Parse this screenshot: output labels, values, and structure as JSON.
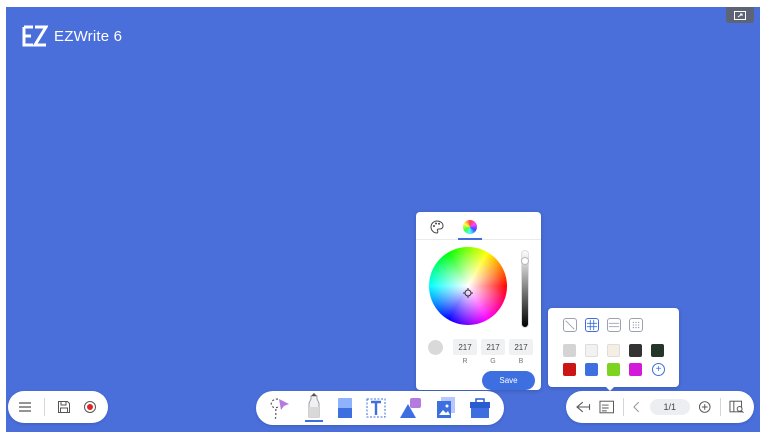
{
  "app": {
    "logo_text": "EZWrite 6"
  },
  "picker": {
    "rgb": {
      "r": "217",
      "g": "217",
      "b": "217"
    },
    "labels": {
      "r": "R",
      "g": "G",
      "b": "B"
    },
    "save_label": "Save",
    "current_color": "#d9d9d9"
  },
  "palette": {
    "swatches": [
      "#d4d4d4",
      "#f2f2f2",
      "#f4efe2",
      "#333333",
      "#24352a",
      "#cc1515",
      "#3d6fe0",
      "#7ed321",
      "#d21ad8"
    ],
    "add_label": "+"
  },
  "pager": {
    "page": "1/1"
  },
  "colors": {
    "canvas": "#4a6fdb",
    "accent": "#3d6fe0"
  },
  "icons": {
    "left": [
      "menu-icon",
      "save-icon",
      "record-icon"
    ],
    "center": [
      "lasso-select-icon",
      "pen-icon",
      "eraser-icon",
      "text-icon",
      "shapes-icon",
      "image-icon",
      "toolbox-icon"
    ],
    "right": [
      "back-icon",
      "notes-icon",
      "prev-page-icon",
      "add-page-icon",
      "page-overview-icon"
    ]
  }
}
